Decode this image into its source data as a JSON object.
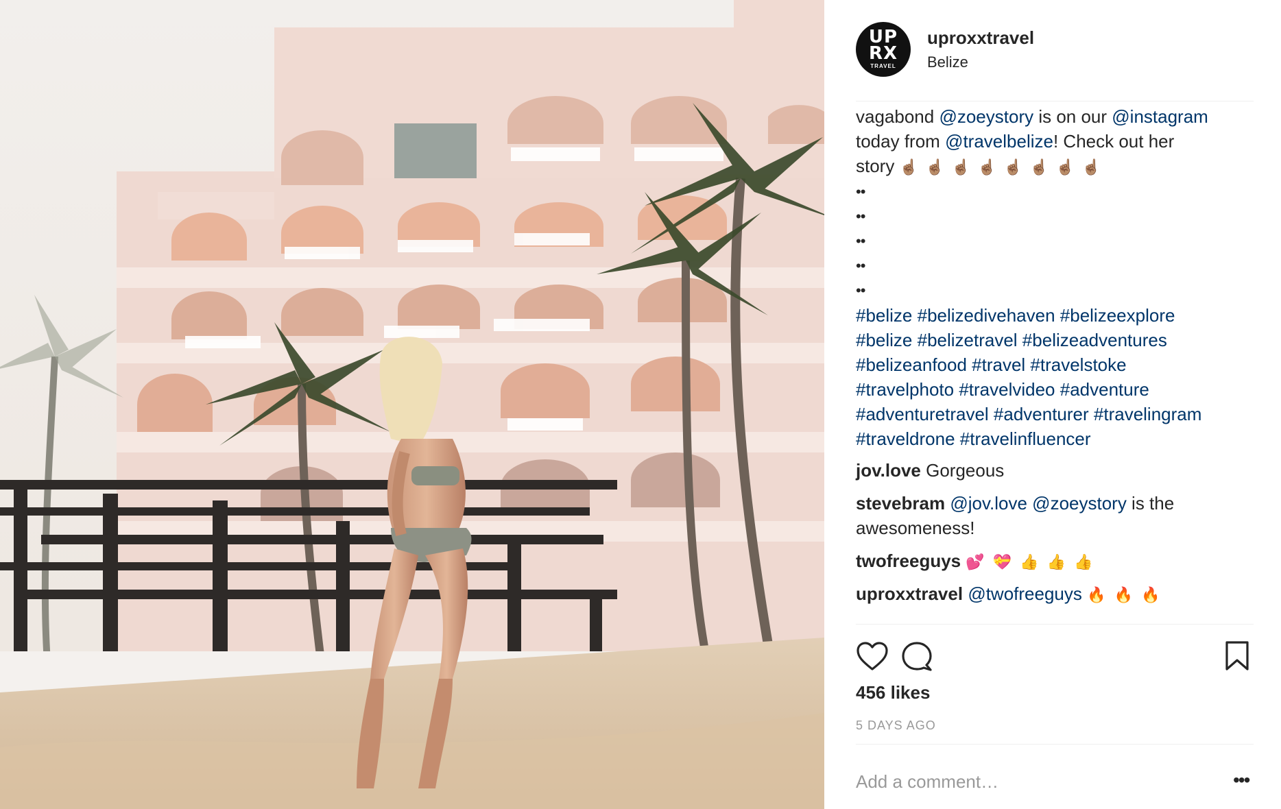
{
  "post": {
    "username": "uproxxtravel",
    "location": "Belize",
    "avatar": {
      "line1": "UP",
      "line2": "RX",
      "line3": "TRAVEL",
      "bg": "#111111"
    }
  },
  "caption": {
    "line1": [
      "vagabond ",
      "@zoeystory",
      " is on our ",
      "@instagram"
    ],
    "line2": [
      "today from ",
      "@travelbelize",
      "! Check out her"
    ],
    "line3_text": "story",
    "hand_emoji": "☝🏽",
    "hand_count": 8,
    "dot_lines": [
      "••",
      "••",
      "••",
      "••",
      "••"
    ],
    "hashtag_lines": [
      "#belize #belizedivehaven #belizeexplore",
      "#belize #belizetravel #belizeadventures",
      "#belizeanfood #travel #travelstoke",
      "#travelphoto #travelvideo #adventure",
      "#adventuretravel #adventurer #travelingram",
      "#traveldrone #travelinfluencer"
    ]
  },
  "comments": [
    {
      "user": "jov.love",
      "text": "Gorgeous"
    },
    {
      "user": "stevebram",
      "mention1": "@jov.love",
      "mention2": "@zoeystory",
      "text_end": " is the",
      "line2": "awesomeness!"
    },
    {
      "user": "twofreeguys",
      "emojis": [
        "💕",
        "💝",
        "👍",
        "👍",
        "👍"
      ]
    },
    {
      "user": "uproxxtravel",
      "mention": "@twofreeguys",
      "emojis": [
        "🔥",
        "🔥",
        "🔥"
      ]
    }
  ],
  "actions": {
    "like_icon": "heart-icon",
    "comment_icon": "comment-bubble-icon",
    "save_icon": "bookmark-icon"
  },
  "likes": "456 likes",
  "time": "5 DAYS AGO",
  "add_comment_placeholder": "Add a comment…",
  "more_options": "•••",
  "colors": {
    "link": "#003569",
    "text": "#262626",
    "muted": "#999999",
    "divider": "#efefef"
  }
}
